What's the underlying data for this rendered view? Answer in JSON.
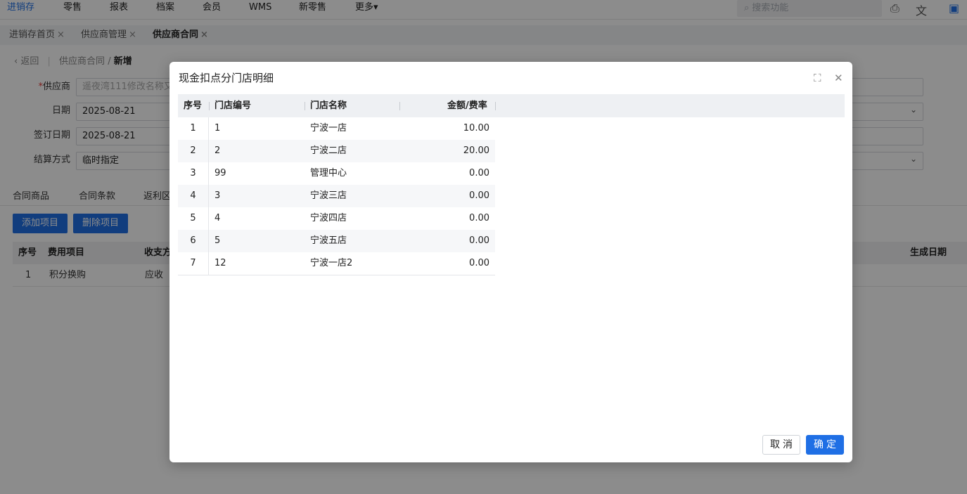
{
  "topnav": {
    "items": [
      "进销存",
      "零售",
      "报表",
      "档案",
      "会员",
      "WMS",
      "新零售",
      "更多"
    ],
    "more_caret": "▾",
    "search_placeholder": "搜索功能"
  },
  "tabs": [
    {
      "label": "进销存首页",
      "close": "×"
    },
    {
      "label": "供应商管理",
      "close": "×"
    },
    {
      "label": "供应商合同",
      "close": "×"
    }
  ],
  "breadcrumb": {
    "back": "返回",
    "parent": "供应商合同",
    "sep": "/",
    "current": "新增"
  },
  "form": {
    "supplier_label": "供应商",
    "supplier_value": "遥夜湾111修改名称又",
    "date_label": "日期",
    "date_value": "2025-08-21",
    "sign_date_label": "签订日期",
    "sign_date_value": "2025-08-21",
    "settle_label": "结算方式",
    "settle_value": "临时指定"
  },
  "subtabs": [
    "合同商品",
    "合同条款",
    "返利区"
  ],
  "buttons": {
    "add": "添加项目",
    "delete": "删除项目"
  },
  "grid": {
    "headers": {
      "seq": "序号",
      "item": "费用项目",
      "dir": "收支方",
      "gen_date": "生成日期"
    },
    "rows": [
      {
        "seq": "1",
        "item": "积分换购",
        "dir": "应收"
      }
    ]
  },
  "modal": {
    "title": "现金扣点分门店明细",
    "headers": {
      "seq": "序号",
      "code": "门店编号",
      "name": "门店名称",
      "amount": "金额/费率"
    },
    "rows": [
      {
        "seq": "1",
        "code": "1",
        "name": "宁波一店",
        "amount": "10.00"
      },
      {
        "seq": "2",
        "code": "2",
        "name": "宁波二店",
        "amount": "20.00"
      },
      {
        "seq": "3",
        "code": "99",
        "name": "管理中心",
        "amount": "0.00"
      },
      {
        "seq": "4",
        "code": "3",
        "name": "宁波三店",
        "amount": "0.00"
      },
      {
        "seq": "5",
        "code": "4",
        "name": "宁波四店",
        "amount": "0.00"
      },
      {
        "seq": "6",
        "code": "5",
        "name": "宁波五店",
        "amount": "0.00"
      },
      {
        "seq": "7",
        "code": "12",
        "name": "宁波一店2",
        "amount": "0.00"
      }
    ],
    "cancel_label": "取消",
    "ok_label": "确定"
  },
  "colors": {
    "accent": "#1f6fe5",
    "overlay": "rgba(0,0,0,0.45)"
  }
}
